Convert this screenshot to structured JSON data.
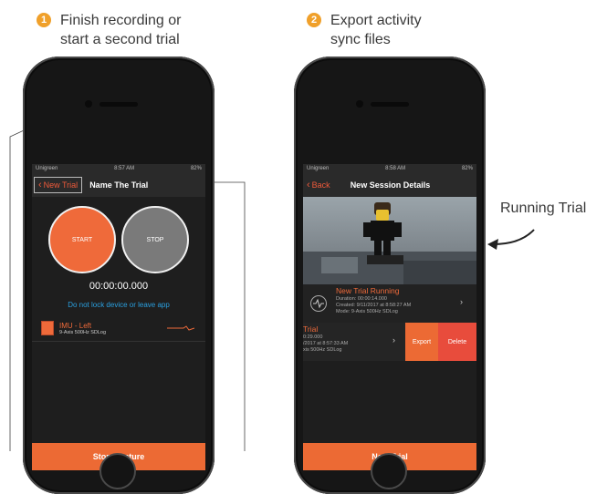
{
  "steps": [
    {
      "num": "1",
      "line1": "Finish recording or",
      "line2": "start a second trial"
    },
    {
      "num": "2",
      "line1": "Export activity",
      "line2": "sync files"
    }
  ],
  "callout": "Running Trial",
  "phone1": {
    "status": {
      "carrier": "Unigreen",
      "time": "8:57 AM",
      "battery": "82%"
    },
    "back_label": "New Trial",
    "title": "Name The Trial",
    "start_label": "START",
    "stop_label": "STOP",
    "timer": "00:00:00.000",
    "warning": "Do not lock device or leave app",
    "sensor": {
      "name": "IMU - Left",
      "sub": "9-Axis 500Hz SDLog"
    },
    "bottom_button": "Stop Capture"
  },
  "phone2": {
    "status": {
      "carrier": "Unigreen",
      "time": "8:58 AM",
      "battery": "82%"
    },
    "back_label": "Back",
    "title": "New Session Details",
    "running": {
      "title": "New Trial Running",
      "duration": "Duration: 00:00:14.000",
      "created": "Created: 9/11/2017 at 8:58:27 AM",
      "mode": "Mode: 9-Axis 500Hz SDLog"
    },
    "trial": {
      "title": "Trial",
      "duration": "0:29.000",
      "created": "/2017 at 8:57:33 AM",
      "mode": "xis 500Hz SDLog"
    },
    "export_label": "Export",
    "delete_label": "Delete",
    "bottom_button": "New Trial"
  },
  "colors": {
    "accent": "#ec6a34",
    "blue": "#2aa0e0",
    "step": "#f0a02a"
  }
}
